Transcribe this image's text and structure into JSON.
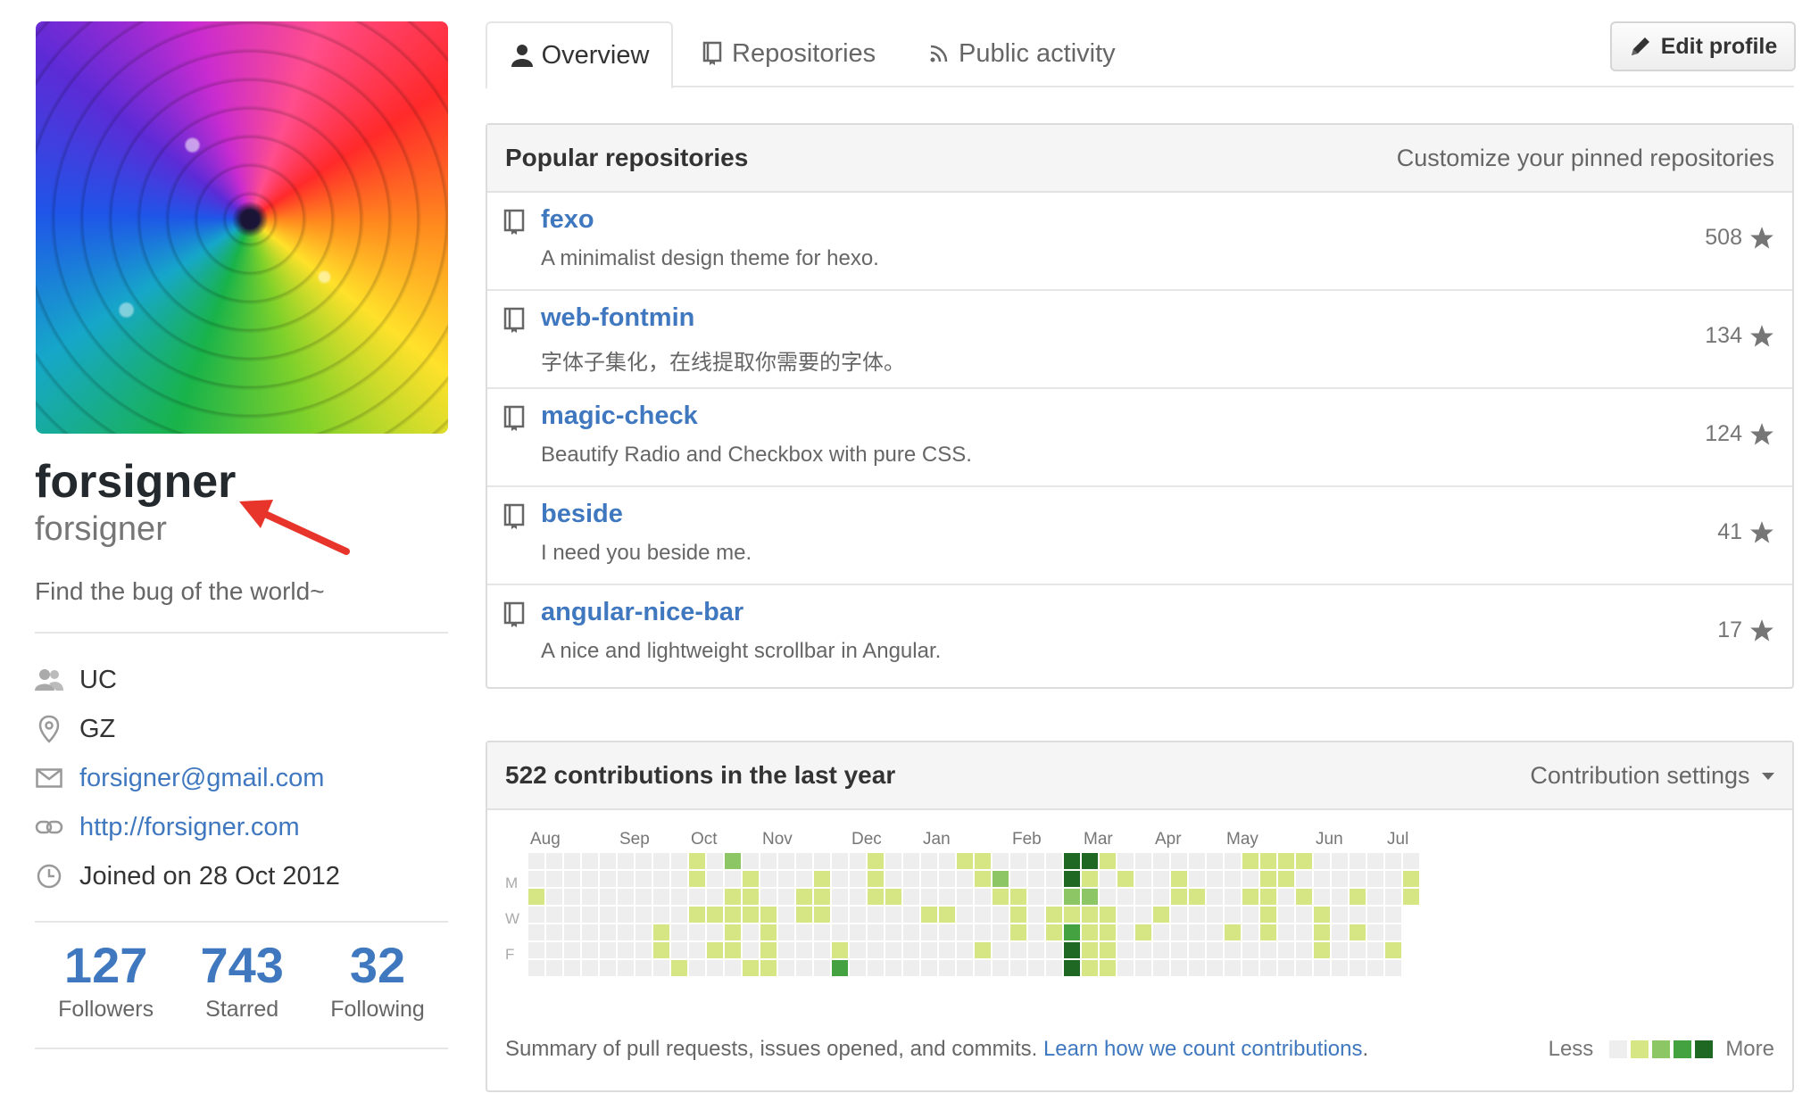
{
  "profile": {
    "full_name": "forsigner",
    "username": "forsigner",
    "bio": "Find the bug of the world~",
    "details": {
      "organization": "UC",
      "location": "GZ",
      "email": "forsigner@gmail.com",
      "website": "http://forsigner.com",
      "joined": "Joined on 28 Oct 2012"
    },
    "stats": [
      {
        "value": "127",
        "label": "Followers"
      },
      {
        "value": "743",
        "label": "Starred"
      },
      {
        "value": "32",
        "label": "Following"
      }
    ]
  },
  "tabs": [
    {
      "label": "Overview",
      "icon": "person-icon"
    },
    {
      "label": "Repositories",
      "icon": "repo-icon"
    },
    {
      "label": "Public activity",
      "icon": "rss-icon"
    }
  ],
  "edit_profile_label": "Edit profile",
  "popular": {
    "title": "Popular repositories",
    "customize_label": "Customize your pinned repositories",
    "repos": [
      {
        "name": "fexo",
        "desc": "A minimalist design theme for hexo.",
        "stars": "508"
      },
      {
        "name": "web-fontmin",
        "desc": "字体子集化，在线提取你需要的字体。",
        "stars": "134"
      },
      {
        "name": "magic-check",
        "desc": "Beautify Radio and Checkbox with pure CSS.",
        "stars": "124"
      },
      {
        "name": "beside",
        "desc": "I need you beside me.",
        "stars": "41"
      },
      {
        "name": "angular-nice-bar",
        "desc": "A nice and lightweight scrollbar in Angular.",
        "stars": "17"
      }
    ]
  },
  "contributions": {
    "title": "522 contributions in the last year",
    "settings_label": "Contribution settings",
    "months": [
      "Aug",
      "Sep",
      "Oct",
      "Nov",
      "Dec",
      "Jan",
      "Feb",
      "Mar",
      "Apr",
      "May",
      "Jun",
      "Jul"
    ],
    "day_labels": [
      "M",
      "W",
      "F"
    ],
    "summary": "Summary of pull requests, issues opened, and commits.",
    "learn_link": "Learn how we count contributions",
    "learn_suffix": ".",
    "legend_less": "Less",
    "legend_more": "More",
    "colors": [
      "#eeeeee",
      "#d6e685",
      "#8cc665",
      "#44a340",
      "#1e6823"
    ],
    "weeks": [
      [
        0,
        0,
        1,
        0,
        0,
        0,
        0
      ],
      [
        0,
        0,
        0,
        0,
        0,
        0,
        0
      ],
      [
        0,
        0,
        0,
        0,
        0,
        0,
        0
      ],
      [
        0,
        0,
        0,
        0,
        0,
        0,
        0
      ],
      [
        0,
        0,
        0,
        0,
        0,
        0,
        0
      ],
      [
        0,
        0,
        0,
        0,
        0,
        0,
        0
      ],
      [
        0,
        0,
        0,
        0,
        0,
        0,
        0
      ],
      [
        0,
        0,
        0,
        0,
        1,
        1,
        0
      ],
      [
        0,
        0,
        0,
        0,
        0,
        0,
        1
      ],
      [
        1,
        1,
        0,
        1,
        0,
        0,
        0
      ],
      [
        0,
        0,
        0,
        1,
        0,
        1,
        0
      ],
      [
        2,
        0,
        1,
        1,
        1,
        1,
        0
      ],
      [
        0,
        1,
        1,
        1,
        0,
        0,
        1
      ],
      [
        0,
        0,
        0,
        1,
        1,
        1,
        1
      ],
      [
        0,
        0,
        0,
        0,
        0,
        0,
        0
      ],
      [
        0,
        0,
        1,
        1,
        0,
        0,
        0
      ],
      [
        0,
        1,
        1,
        1,
        0,
        0,
        0
      ],
      [
        0,
        0,
        0,
        0,
        0,
        1,
        3
      ],
      [
        0,
        0,
        0,
        0,
        0,
        0,
        0
      ],
      [
        1,
        1,
        1,
        0,
        0,
        0,
        0
      ],
      [
        0,
        0,
        1,
        0,
        0,
        0,
        0
      ],
      [
        0,
        0,
        0,
        0,
        0,
        0,
        0
      ],
      [
        0,
        0,
        0,
        1,
        0,
        0,
        0
      ],
      [
        0,
        0,
        0,
        1,
        0,
        0,
        0
      ],
      [
        1,
        0,
        0,
        0,
        0,
        0,
        0
      ],
      [
        1,
        1,
        0,
        0,
        0,
        1,
        0
      ],
      [
        0,
        2,
        1,
        0,
        0,
        0,
        0
      ],
      [
        0,
        0,
        1,
        1,
        1,
        0,
        0
      ],
      [
        0,
        0,
        0,
        0,
        0,
        0,
        0
      ],
      [
        0,
        0,
        0,
        1,
        1,
        0,
        0
      ],
      [
        4,
        4,
        2,
        1,
        3,
        4,
        4
      ],
      [
        4,
        1,
        2,
        1,
        1,
        1,
        1
      ],
      [
        1,
        0,
        0,
        1,
        1,
        1,
        1
      ],
      [
        0,
        1,
        0,
        0,
        0,
        0,
        0
      ],
      [
        0,
        0,
        0,
        0,
        1,
        0,
        0
      ],
      [
        0,
        0,
        0,
        1,
        0,
        0,
        0
      ],
      [
        0,
        1,
        1,
        0,
        0,
        0,
        0
      ],
      [
        0,
        0,
        1,
        0,
        0,
        0,
        0
      ],
      [
        0,
        0,
        0,
        0,
        0,
        0,
        0
      ],
      [
        0,
        0,
        0,
        0,
        1,
        0,
        0
      ],
      [
        1,
        0,
        1,
        0,
        0,
        0,
        0
      ],
      [
        1,
        1,
        1,
        1,
        1,
        0,
        0
      ],
      [
        1,
        1,
        0,
        0,
        0,
        0,
        0
      ],
      [
        1,
        0,
        1,
        0,
        0,
        0,
        0
      ],
      [
        0,
        0,
        0,
        1,
        1,
        1,
        0
      ],
      [
        0,
        0,
        0,
        0,
        0,
        0,
        0
      ],
      [
        0,
        0,
        1,
        0,
        1,
        0,
        0
      ],
      [
        0,
        0,
        0,
        0,
        0,
        0,
        0
      ],
      [
        0,
        0,
        0,
        0,
        0,
        1,
        0
      ],
      [
        0,
        1,
        1
      ]
    ]
  }
}
